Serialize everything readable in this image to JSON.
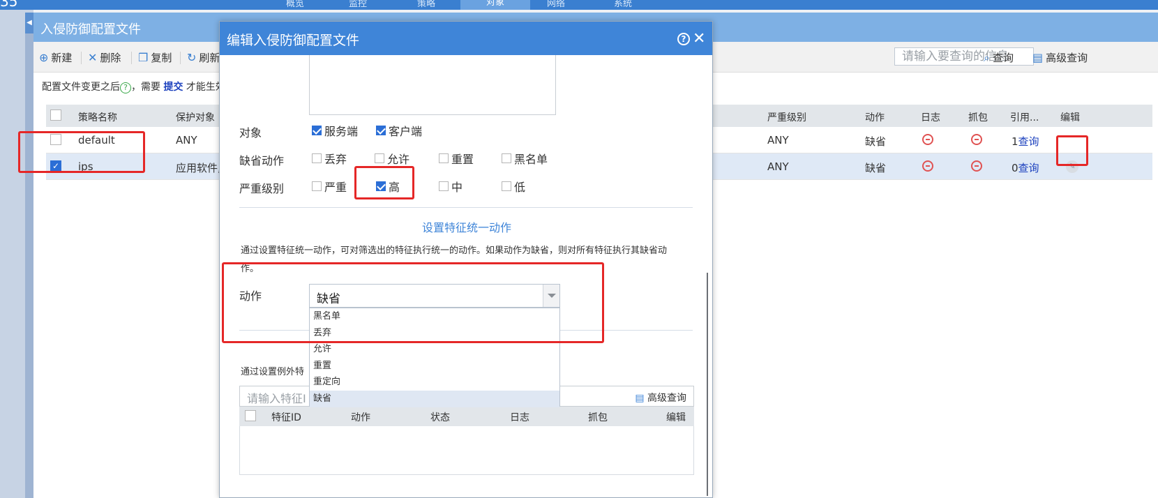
{
  "topnav": {
    "logo": "35",
    "tabs": [
      "概览",
      "监控",
      "策略",
      "对象",
      "网络",
      "系统"
    ],
    "active_tab": "对象"
  },
  "panel": {
    "title": "入侵防御配置文件",
    "collapse_icon": "triangle-left"
  },
  "toolbar": {
    "new_label": "新建",
    "delete_label": "删除",
    "copy_label": "复制",
    "refresh_label": "刷新",
    "search_placeholder": "请输入要查询的信息",
    "query_label": "查询",
    "advanced_query_label": "高级查询"
  },
  "notice": {
    "prefix": "配置文件变更之后",
    "help_glyph": "?",
    "middle": "，需要 ",
    "link": "提交",
    "suffix": " 才能生效"
  },
  "table": {
    "columns": {
      "name": "策略名称",
      "target": "保护对象",
      "severity": "严重级别",
      "action": "动作",
      "log": "日志",
      "capture": "抓包",
      "ref": "引用...",
      "edit": "编辑"
    },
    "rows": [
      {
        "checked": false,
        "name": "default",
        "target": "ANY",
        "severity": "ANY",
        "action": "缺省",
        "ref_count": "1",
        "ref_link": "查询"
      },
      {
        "checked": true,
        "name": "ips",
        "target": "应用软件,",
        "severity": "ANY",
        "action": "缺省",
        "ref_count": "0",
        "ref_link": "查询"
      }
    ]
  },
  "modal": {
    "title": "编辑入侵防御配置文件",
    "help_glyph": "?",
    "close_glyph": "✕",
    "object_label": "对象",
    "object_options": [
      {
        "label": "服务端",
        "checked": true
      },
      {
        "label": "客户端",
        "checked": true
      }
    ],
    "default_action_label": "缺省动作",
    "default_action_options": [
      {
        "label": "丢弃",
        "checked": false
      },
      {
        "label": "允许",
        "checked": false
      },
      {
        "label": "重置",
        "checked": false
      },
      {
        "label": "黑名单",
        "checked": false
      }
    ],
    "severity_label": "严重级别",
    "severity_options": [
      {
        "label": "严重",
        "checked": false
      },
      {
        "label": "高",
        "checked": true
      },
      {
        "label": "中",
        "checked": false
      },
      {
        "label": "低",
        "checked": false
      }
    ],
    "unify_section_title": "设置特征统一动作",
    "unify_desc": "通过设置特征统一动作，可对筛选出的特征执行统一的动作。如果动作为缺省，则对所有特征执行其缺省动作。",
    "action_label": "动作",
    "action_value": "缺省",
    "action_options": [
      "黑名单",
      "丢弃",
      "允许",
      "重置",
      "重定向",
      "缺省"
    ],
    "action_selected": "缺省",
    "exception_desc": "通过设置例外特",
    "exception_search_placeholder": "请输入特征I",
    "exception_adv_query": "高级查询",
    "exception_columns": [
      "特征ID",
      "动作",
      "状态",
      "日志",
      "抓包",
      "编辑"
    ]
  },
  "colors": {
    "accent": "#3f85d8",
    "highlight": "#e52727",
    "link": "#1a3fbd"
  }
}
